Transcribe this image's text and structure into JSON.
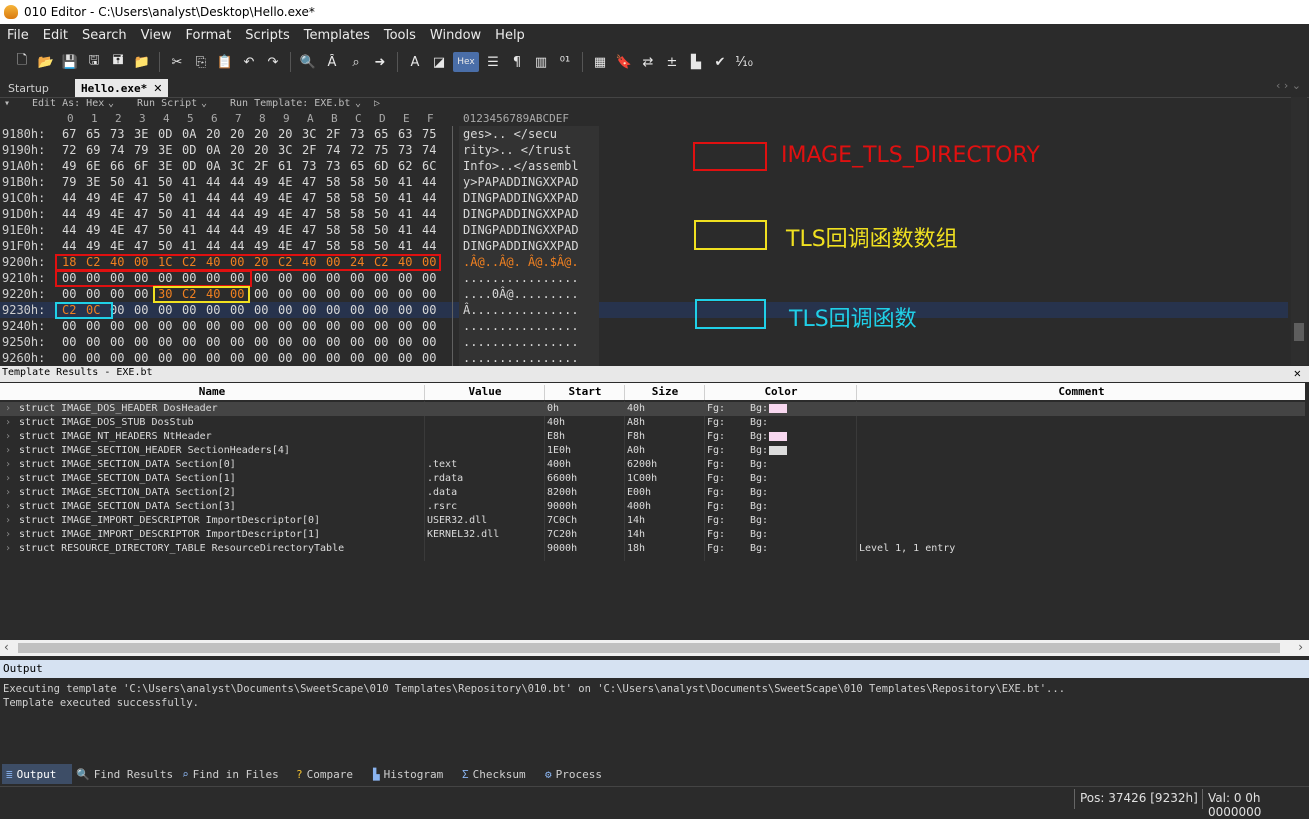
{
  "window": {
    "title": "010 Editor - C:\\Users\\analyst\\Desktop\\Hello.exe*"
  },
  "menu": [
    "File",
    "Edit",
    "Search",
    "View",
    "Format",
    "Scripts",
    "Templates",
    "Tools",
    "Window",
    "Help"
  ],
  "toolbar_icons": [
    "new-file",
    "open",
    "save",
    "save-as",
    "save-all",
    "open-folder",
    "cut",
    "copy",
    "paste",
    "undo",
    "redo",
    "find",
    "replace",
    "find-in-files",
    "goto",
    "font",
    "highlight",
    "hex-mode",
    "columns",
    "paragraph",
    "columns-view",
    "binary",
    "calculator",
    "bookmark",
    "swap",
    "compare",
    "histogram",
    "checksum",
    "base-convert"
  ],
  "toolbar_hex_label": "Hex",
  "tabs": {
    "startup": "Startup",
    "file": "Hello.exe*"
  },
  "editbar": {
    "edit_as": "Edit As: Hex",
    "run_script": "Run Script",
    "run_template": "Run Template: EXE.bt"
  },
  "hex": {
    "col_headers": [
      "0",
      "1",
      "2",
      "3",
      "4",
      "5",
      "6",
      "7",
      "8",
      "9",
      "A",
      "B",
      "C",
      "D",
      "E",
      "F"
    ],
    "ascii_header": "0123456789ABCDEF",
    "rows": [
      {
        "offset": "9180h:",
        "bytes": [
          "67",
          "65",
          "73",
          "3E",
          "0D",
          "0A",
          "20",
          "20",
          "20",
          "20",
          "3C",
          "2F",
          "73",
          "65",
          "63",
          "75"
        ],
        "ascii": "ges>..    </secu"
      },
      {
        "offset": "9190h:",
        "bytes": [
          "72",
          "69",
          "74",
          "79",
          "3E",
          "0D",
          "0A",
          "20",
          "20",
          "3C",
          "2F",
          "74",
          "72",
          "75",
          "73",
          "74"
        ],
        "ascii": "rity>..  </trust"
      },
      {
        "offset": "91A0h:",
        "bytes": [
          "49",
          "6E",
          "66",
          "6F",
          "3E",
          "0D",
          "0A",
          "3C",
          "2F",
          "61",
          "73",
          "73",
          "65",
          "6D",
          "62",
          "6C"
        ],
        "ascii": "Info>..</assembl"
      },
      {
        "offset": "91B0h:",
        "bytes": [
          "79",
          "3E",
          "50",
          "41",
          "50",
          "41",
          "44",
          "44",
          "49",
          "4E",
          "47",
          "58",
          "58",
          "50",
          "41",
          "44"
        ],
        "ascii": "y>PAPADDINGXXPAD"
      },
      {
        "offset": "91C0h:",
        "bytes": [
          "44",
          "49",
          "4E",
          "47",
          "50",
          "41",
          "44",
          "44",
          "49",
          "4E",
          "47",
          "58",
          "58",
          "50",
          "41",
          "44"
        ],
        "ascii": "DINGPADDINGXXPAD"
      },
      {
        "offset": "91D0h:",
        "bytes": [
          "44",
          "49",
          "4E",
          "47",
          "50",
          "41",
          "44",
          "44",
          "49",
          "4E",
          "47",
          "58",
          "58",
          "50",
          "41",
          "44"
        ],
        "ascii": "DINGPADDINGXXPAD"
      },
      {
        "offset": "91E0h:",
        "bytes": [
          "44",
          "49",
          "4E",
          "47",
          "50",
          "41",
          "44",
          "44",
          "49",
          "4E",
          "47",
          "58",
          "58",
          "50",
          "41",
          "44"
        ],
        "ascii": "DINGPADDINGXXPAD"
      },
      {
        "offset": "91F0h:",
        "bytes": [
          "44",
          "49",
          "4E",
          "47",
          "50",
          "41",
          "44",
          "44",
          "49",
          "4E",
          "47",
          "58",
          "58",
          "50",
          "41",
          "44"
        ],
        "ascii": "DINGPADDINGXXPAD"
      },
      {
        "offset": "9200h:",
        "bytes": [
          "18",
          "C2",
          "40",
          "00",
          "1C",
          "C2",
          "40",
          "00",
          "20",
          "C2",
          "40",
          "00",
          "24",
          "C2",
          "40",
          "00"
        ],
        "ascii": ".Â@..Â@. Â@.$Â@.",
        "orange": [
          0,
          1,
          2,
          3,
          4,
          5,
          6,
          7,
          8,
          9,
          10,
          11,
          12,
          13,
          14,
          15
        ],
        "ascii_orange": true
      },
      {
        "offset": "9210h:",
        "bytes": [
          "00",
          "00",
          "00",
          "00",
          "00",
          "00",
          "00",
          "00",
          "00",
          "00",
          "00",
          "00",
          "00",
          "00",
          "00",
          "00"
        ],
        "ascii": "................"
      },
      {
        "offset": "9220h:",
        "bytes": [
          "00",
          "00",
          "00",
          "00",
          "30",
          "C2",
          "40",
          "00",
          "00",
          "00",
          "00",
          "00",
          "00",
          "00",
          "00",
          "00"
        ],
        "ascii": "....0Â@.........",
        "orange": [
          4,
          5,
          6,
          7
        ]
      },
      {
        "offset": "9230h:",
        "bytes": [
          "C2",
          "0C",
          "00",
          "00",
          "00",
          "00",
          "00",
          "00",
          "00",
          "00",
          "00",
          "00",
          "00",
          "00",
          "00",
          "00"
        ],
        "ascii": "Â...............",
        "orange": [
          0,
          1
        ],
        "selected": true
      },
      {
        "offset": "9240h:",
        "bytes": [
          "00",
          "00",
          "00",
          "00",
          "00",
          "00",
          "00",
          "00",
          "00",
          "00",
          "00",
          "00",
          "00",
          "00",
          "00",
          "00"
        ],
        "ascii": "................"
      },
      {
        "offset": "9250h:",
        "bytes": [
          "00",
          "00",
          "00",
          "00",
          "00",
          "00",
          "00",
          "00",
          "00",
          "00",
          "00",
          "00",
          "00",
          "00",
          "00",
          "00"
        ],
        "ascii": "................"
      },
      {
        "offset": "9260h:",
        "bytes": [
          "00",
          "00",
          "00",
          "00",
          "00",
          "00",
          "00",
          "00",
          "00",
          "00",
          "00",
          "00",
          "00",
          "00",
          "00",
          "00"
        ],
        "ascii": "................"
      }
    ]
  },
  "annotations": {
    "red": {
      "label": "IMAGE_TLS_DIRECTORY",
      "color": "#e01010"
    },
    "yellow": {
      "label": "TLS回调函数数组",
      "color": "#f0e020"
    },
    "cyan": {
      "label": "TLS回调函数",
      "color": "#20d0e8"
    }
  },
  "template_results": {
    "title": "Template Results - EXE.bt",
    "columns": [
      "Name",
      "Value",
      "Start",
      "Size",
      "Color",
      "Comment"
    ],
    "rows": [
      {
        "name": "struct IMAGE_DOS_HEADER DosHeader",
        "value": "",
        "start": "0h",
        "size": "40h",
        "fg": "Fg:",
        "bg": "Bg:",
        "bg_color": "#f8d8f0",
        "comment": ""
      },
      {
        "name": "struct IMAGE_DOS_STUB DosStub",
        "value": "",
        "start": "40h",
        "size": "A8h",
        "fg": "Fg:",
        "bg": "Bg:",
        "bg_color": "",
        "comment": ""
      },
      {
        "name": "struct IMAGE_NT_HEADERS NtHeader",
        "value": "",
        "start": "E8h",
        "size": "F8h",
        "fg": "Fg:",
        "bg": "Bg:",
        "bg_color": "#f8d8f0",
        "comment": ""
      },
      {
        "name": "struct IMAGE_SECTION_HEADER SectionHeaders[4]",
        "value": "",
        "start": "1E0h",
        "size": "A0h",
        "fg": "Fg:",
        "bg": "Bg:",
        "bg_color": "#dcdcdc",
        "comment": ""
      },
      {
        "name": "struct IMAGE_SECTION_DATA Section[0]",
        "value": ".text",
        "start": "400h",
        "size": "6200h",
        "fg": "Fg:",
        "bg": "Bg:",
        "bg_color": "",
        "comment": ""
      },
      {
        "name": "struct IMAGE_SECTION_DATA Section[1]",
        "value": ".rdata",
        "start": "6600h",
        "size": "1C00h",
        "fg": "Fg:",
        "bg": "Bg:",
        "bg_color": "",
        "comment": ""
      },
      {
        "name": "struct IMAGE_SECTION_DATA Section[2]",
        "value": ".data",
        "start": "8200h",
        "size": "E00h",
        "fg": "Fg:",
        "bg": "Bg:",
        "bg_color": "",
        "comment": ""
      },
      {
        "name": "struct IMAGE_SECTION_DATA Section[3]",
        "value": ".rsrc",
        "start": "9000h",
        "size": "400h",
        "fg": "Fg:",
        "bg": "Bg:",
        "bg_color": "",
        "comment": ""
      },
      {
        "name": "struct IMAGE_IMPORT_DESCRIPTOR ImportDescriptor[0]",
        "value": "USER32.dll",
        "start": "7C0Ch",
        "size": "14h",
        "fg": "Fg:",
        "bg": "Bg:",
        "bg_color": "",
        "comment": ""
      },
      {
        "name": "struct IMAGE_IMPORT_DESCRIPTOR ImportDescriptor[1]",
        "value": "KERNEL32.dll",
        "start": "7C20h",
        "size": "14h",
        "fg": "Fg:",
        "bg": "Bg:",
        "bg_color": "",
        "comment": ""
      },
      {
        "name": "struct RESOURCE_DIRECTORY_TABLE ResourceDirectoryTable",
        "value": "",
        "start": "9000h",
        "size": "18h",
        "fg": "Fg:",
        "bg": "Bg:",
        "bg_color": "",
        "comment": "Level 1, 1 entry"
      }
    ]
  },
  "output": {
    "title": "Output",
    "lines": [
      "Executing template 'C:\\Users\\analyst\\Documents\\SweetScape\\010 Templates\\Repository\\010.bt' on 'C:\\Users\\analyst\\Documents\\SweetScape\\010 Templates\\Repository\\EXE.bt'...",
      "Template executed successfully."
    ]
  },
  "bottom_tabs": [
    "Output",
    "Find Results",
    "Find in Files",
    "Compare",
    "Histogram",
    "Checksum",
    "Process"
  ],
  "status": {
    "pos": "Pos: 37426 [9232h]",
    "val": "Val: 0 0h 0000000"
  }
}
